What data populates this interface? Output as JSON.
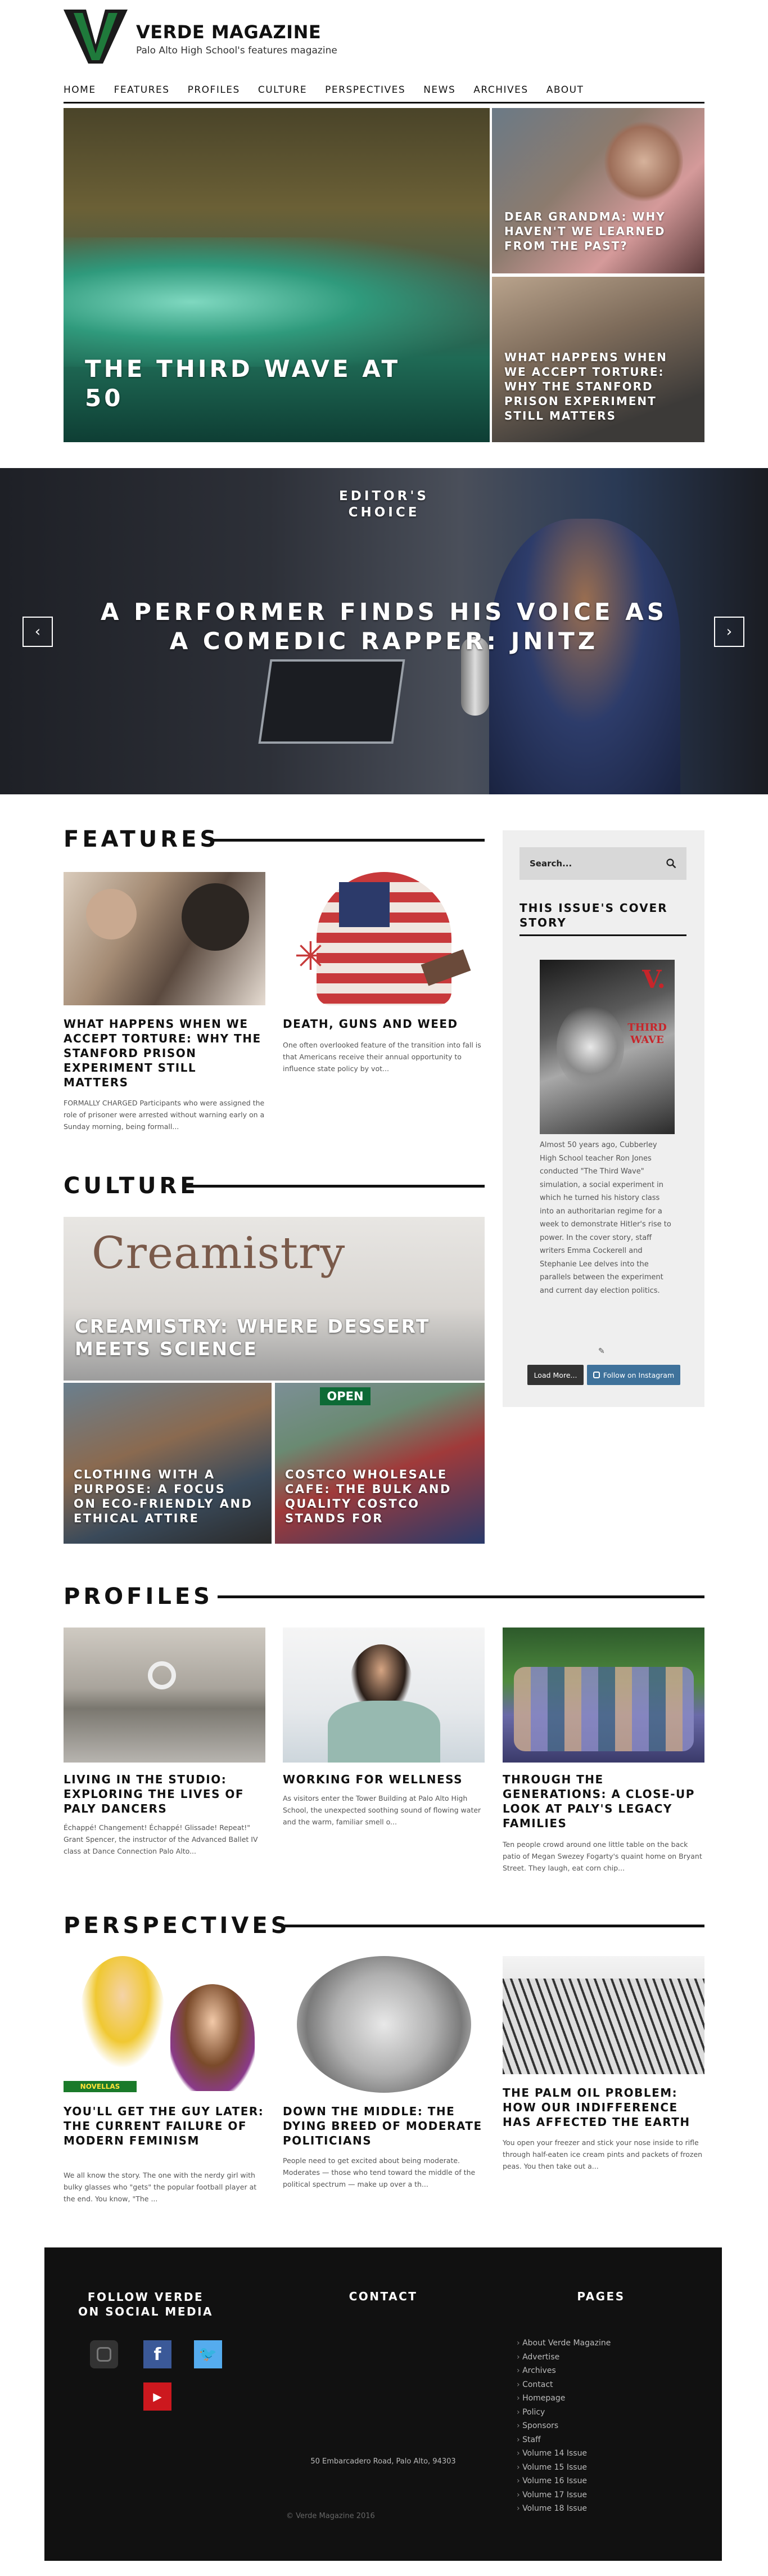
{
  "site": {
    "title": "VERDE MAGAZINE",
    "subtitle": "Palo Alto High School's features magazine"
  },
  "nav": [
    "HOME",
    "FEATURES",
    "PROFILES",
    "CULTURE",
    "PERSPECTIVES",
    "NEWS",
    "ARCHIVES",
    "ABOUT"
  ],
  "hero": {
    "main": "THE THIRD WAVE AT 50",
    "side_top": "DEAR GRANDMA: WHY HAVEN'T WE LEARNED FROM THE PAST?",
    "side_bottom": "WHAT HAPPENS WHEN WE ACCEPT TORTURE: WHY THE STANFORD PRISON EXPERIMENT STILL MATTERS"
  },
  "editors_choice": {
    "label": "EDITOR'S CHOICE",
    "title": "A PERFORMER FINDS HIS VOICE AS A COMEDIC RAPPER: JNITZ",
    "prev": "‹",
    "next": "›"
  },
  "features": {
    "heading": "FEATURES",
    "items": [
      {
        "title": "WHAT HAPPENS WHEN WE ACCEPT TORTURE: WHY THE STANFORD PRISON EXPERIMENT STILL MATTERS",
        "excerpt": "FORMALLY CHARGED Participants who were assigned the role of prisoner were arrested without warning early on a Sunday morning, being formall..."
      },
      {
        "title": "DEATH, GUNS AND WEED",
        "excerpt": "One often overlooked feature of the transition into fall is that Americans receive their annual opportunity to influence state policy by vot..."
      }
    ]
  },
  "culture": {
    "heading": "CULTURE",
    "main": "CREAMISTRY: WHERE DESSERT MEETS SCIENCE",
    "sign": "Creamistry",
    "sub_left": "CLOTHING WITH A PURPOSE: A FOCUS ON ECO-FRIENDLY AND ETHICAL ATTIRE",
    "sub_right": "COSTCO WHOLESALE CAFE: THE BULK AND QUALITY COSTCO STANDS FOR",
    "open_sign": "OPEN"
  },
  "sidebar": {
    "search_placeholder": "Search...",
    "cover_heading": "THIS ISSUE'S COVER STORY",
    "cover_mag_letter": "V.",
    "cover_mag_title": "THIRD WAVE",
    "cover_text": "Almost 50 years ago, Cubberley High School teacher Ron Jones conducted \"The Third Wave\" simulation, a social experiment in which he turned his history class into an authoritarian regime for a week to demonstrate Hitler's rise to power. In the cover story, staff writers Emma Cockerell and Stephanie Lee delves into the parallels between the experiment and current day election politics.",
    "load_more": "Load More...",
    "follow_instagram": "Follow on Instagram"
  },
  "profiles": {
    "heading": "PROFILES",
    "items": [
      {
        "title": "LIVING IN THE STUDIO: EXPLORING THE LIVES OF PALY DANCERS",
        "excerpt": "Échappé! Changement! Échappé! Glissade! Repeat!\" Grant Spencer, the instructor of the Advanced Ballet IV class at Dance Connection Palo Alto..."
      },
      {
        "title": "WORKING FOR WELLNESS",
        "excerpt": "As visitors enter the Tower Building at Palo Alto High School, the unexpected soothing sound of flowing water and the warm, familiar smell o..."
      },
      {
        "title": "THROUGH THE GENERATIONS: A CLOSE-UP LOOK AT PALY'S LEGACY FAMILIES",
        "excerpt": "Ten people crowd around one little table on the back patio of Megan Swezey Fogarty's quaint home on Bryant Street. They laugh, eat corn chip..."
      }
    ]
  },
  "perspectives": {
    "heading": "PERSPECTIVES",
    "novellas_label": "NOVELLAS",
    "items": [
      {
        "title": "YOU'LL GET THE GUY LATER: THE CURRENT FAILURE OF MODERN FEMINISM",
        "excerpt": "We all know the story. The one with the nerdy girl with bulky glasses who \"gets\" the popular football player at the end. You know, \"The ..."
      },
      {
        "title": "DOWN THE MIDDLE: THE DYING BREED OF MODERATE POLITICIANS",
        "excerpt": "People need to get excited about being moderate. Moderates — those who tend toward the middle of the political spectrum — make up over a th..."
      },
      {
        "title": "THE PALM OIL PROBLEM: HOW OUR INDIFFERENCE HAS AFFECTED THE EARTH",
        "excerpt": "You open your freezer and stick your nose inside to rifle through half-eaten ice cream pints and packets of frozen peas. You then take out a..."
      }
    ]
  },
  "footer": {
    "social_heading": "FOLLOW VERDE ON SOCIAL MEDIA",
    "contact_heading": "CONTACT",
    "pages_heading": "PAGES",
    "address": "50 Embarcadero Road, Palo Alto, 94303",
    "copyright": "© Verde Magazine 2016",
    "pages": [
      "About Verde Magazine",
      "Advertise",
      "Archives",
      "Contact",
      "Homepage",
      "Policy",
      "Sponsors",
      "Staff",
      "Volume 14 Issue",
      "Volume 15 Issue",
      "Volume 16 Issue",
      "Volume 17 Issue",
      "Volume 18 Issue"
    ]
  },
  "colors": {
    "brand_green": "#1f7a3b",
    "footer_bg": "#111111",
    "instagram_blue": "#3f729b",
    "facebook_blue": "#3b5998",
    "twitter_blue": "#55acee",
    "youtube_red": "#cc181e"
  }
}
